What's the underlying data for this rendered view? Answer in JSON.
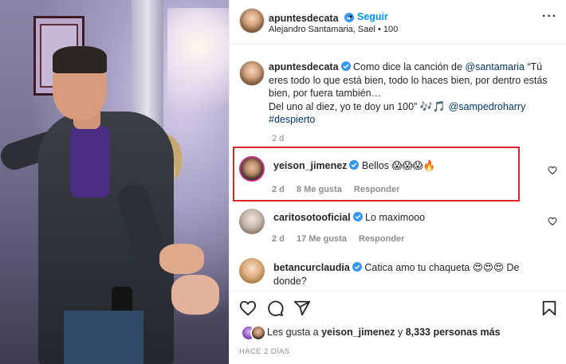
{
  "post": {
    "author": "apuntesdecata",
    "follow_label": "Seguir",
    "separator": "•",
    "subline": "Alejandro Santamaria, Sael • 100",
    "more_label": "···"
  },
  "caption": {
    "username": "apuntesdecata",
    "text_1": "Como dice la canción de ",
    "mention_1": "@santamaria",
    "text_2": " “Tú eres todo lo que está bien, todo lo haces bien, por dentro estás bien, por fuera también…",
    "text_3": "Del uno al diez, yo te doy un 100”",
    "emoji_1": "🎶🎵",
    "mention_2": "@sampedroharry",
    "hashtag": "#despierto",
    "time": "2 d"
  },
  "comments": [
    {
      "username": "yeison_jimenez",
      "text": "Bellos",
      "emojis": "😱😱😱🔥",
      "time": "2 d",
      "likes": "8 Me gusta",
      "reply": "Responder"
    },
    {
      "username": "caritosotooficial",
      "text": "Lo maximooo",
      "time": "2 d",
      "likes": "17 Me gusta",
      "reply": "Responder"
    },
    {
      "username": "betancurclaudia",
      "text_1": "Catica amo tu chaqueta ",
      "emojis": "😍😍😍",
      "text_2": " De",
      "text_3": "donde?"
    }
  ],
  "likes": {
    "prefix": "Les gusta a ",
    "user": "yeison_jimenez",
    "middle": " y ",
    "count": "8,333 personas más"
  },
  "timestamp": "HACE 2 DÍAS",
  "colors": {
    "accent": "#0095f6",
    "verified": "#3897f0",
    "highlight": "#d9252a",
    "muted": "#8e8e8e"
  },
  "icons": [
    "heart-icon",
    "comment-icon",
    "share-icon",
    "bookmark-icon",
    "verified-icon",
    "more-icon"
  ]
}
